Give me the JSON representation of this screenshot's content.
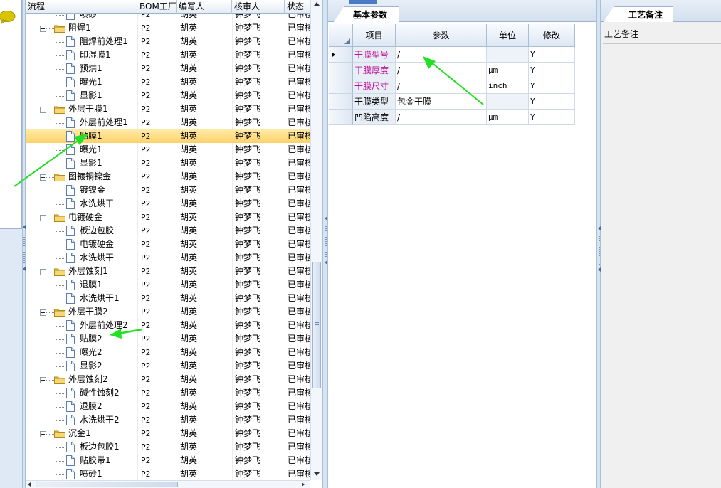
{
  "tree": {
    "columns": [
      "流程",
      "BOM工厂",
      "编写人",
      "核审人",
      "状态"
    ],
    "rows": [
      {
        "level": 1,
        "label": "喷砂",
        "bom": "P2",
        "writer": "胡英",
        "reviewer": "钟梦飞",
        "status": "已审核",
        "last_in_group": true
      },
      {
        "level": 0,
        "label": "阻焊1",
        "bom": "P2",
        "writer": "胡英",
        "reviewer": "钟梦飞",
        "status": "已审核"
      },
      {
        "level": 1,
        "label": "阻焊前处理1",
        "bom": "P2",
        "writer": "胡英",
        "reviewer": "钟梦飞",
        "status": "已审核"
      },
      {
        "level": 1,
        "label": "印湿膜1",
        "bom": "P2",
        "writer": "胡英",
        "reviewer": "钟梦飞",
        "status": "已审核"
      },
      {
        "level": 1,
        "label": "预烘1",
        "bom": "P2",
        "writer": "胡英",
        "reviewer": "钟梦飞",
        "status": "已审核"
      },
      {
        "level": 1,
        "label": "曝光1",
        "bom": "P2",
        "writer": "胡英",
        "reviewer": "钟梦飞",
        "status": "已审核"
      },
      {
        "level": 1,
        "label": "显影1",
        "bom": "P2",
        "writer": "胡英",
        "reviewer": "钟梦飞",
        "status": "已审核",
        "last_in_group": true
      },
      {
        "level": 0,
        "label": "外层干膜1",
        "bom": "P2",
        "writer": "胡英",
        "reviewer": "钟梦飞",
        "status": "已审核"
      },
      {
        "level": 1,
        "label": "外层前处理1",
        "bom": "P2",
        "writer": "胡英",
        "reviewer": "钟梦飞",
        "status": "已审核"
      },
      {
        "level": 1,
        "label": "贴膜1",
        "bom": "P2",
        "writer": "胡英",
        "reviewer": "钟梦飞",
        "status": "已审核",
        "selected": true
      },
      {
        "level": 1,
        "label": "曝光1",
        "bom": "P2",
        "writer": "胡英",
        "reviewer": "钟梦飞",
        "status": "已审核"
      },
      {
        "level": 1,
        "label": "显影1",
        "bom": "P2",
        "writer": "胡英",
        "reviewer": "钟梦飞",
        "status": "已审核",
        "last_in_group": true
      },
      {
        "level": 0,
        "label": "图镀铜镍金",
        "bom": "P2",
        "writer": "胡英",
        "reviewer": "钟梦飞",
        "status": "已审核"
      },
      {
        "level": 1,
        "label": "镀镍金",
        "bom": "P2",
        "writer": "胡英",
        "reviewer": "钟梦飞",
        "status": "已审核"
      },
      {
        "level": 1,
        "label": "水洗烘干",
        "bom": "P2",
        "writer": "胡英",
        "reviewer": "钟梦飞",
        "status": "已审核",
        "last_in_group": true
      },
      {
        "level": 0,
        "label": "电镀硬金",
        "bom": "P2",
        "writer": "胡英",
        "reviewer": "钟梦飞",
        "status": "已审核"
      },
      {
        "level": 1,
        "label": "板边包胶",
        "bom": "P2",
        "writer": "胡英",
        "reviewer": "钟梦飞",
        "status": "已审核"
      },
      {
        "level": 1,
        "label": "电镀硬金",
        "bom": "P2",
        "writer": "胡英",
        "reviewer": "钟梦飞",
        "status": "已审核"
      },
      {
        "level": 1,
        "label": "水洗烘干",
        "bom": "P2",
        "writer": "胡英",
        "reviewer": "钟梦飞",
        "status": "已审核",
        "last_in_group": true
      },
      {
        "level": 0,
        "label": "外层蚀刻1",
        "bom": "P2",
        "writer": "胡英",
        "reviewer": "钟梦飞",
        "status": "已审核"
      },
      {
        "level": 1,
        "label": "退膜1",
        "bom": "P2",
        "writer": "胡英",
        "reviewer": "钟梦飞",
        "status": "已审核"
      },
      {
        "level": 1,
        "label": "水洗烘干1",
        "bom": "P2",
        "writer": "胡英",
        "reviewer": "钟梦飞",
        "status": "已审核",
        "last_in_group": true
      },
      {
        "level": 0,
        "label": "外层干膜2",
        "bom": "P2",
        "writer": "胡英",
        "reviewer": "钟梦飞",
        "status": "已审核"
      },
      {
        "level": 1,
        "label": "外层前处理2",
        "bom": "P2",
        "writer": "胡英",
        "reviewer": "钟梦飞",
        "status": "已审核"
      },
      {
        "level": 1,
        "label": "贴膜2",
        "bom": "P2",
        "writer": "胡英",
        "reviewer": "钟梦飞",
        "status": "已审核"
      },
      {
        "level": 1,
        "label": "曝光2",
        "bom": "P2",
        "writer": "胡英",
        "reviewer": "钟梦飞",
        "status": "已审核"
      },
      {
        "level": 1,
        "label": "显影2",
        "bom": "P2",
        "writer": "胡英",
        "reviewer": "钟梦飞",
        "status": "已审核",
        "last_in_group": true
      },
      {
        "level": 0,
        "label": "外层蚀刻2",
        "bom": "P2",
        "writer": "胡英",
        "reviewer": "钟梦飞",
        "status": "已审核"
      },
      {
        "level": 1,
        "label": "碱性蚀刻2",
        "bom": "P2",
        "writer": "胡英",
        "reviewer": "钟梦飞",
        "status": "已审核"
      },
      {
        "level": 1,
        "label": "退膜2",
        "bom": "P2",
        "writer": "胡英",
        "reviewer": "钟梦飞",
        "status": "已审核"
      },
      {
        "level": 1,
        "label": "水洗烘干2",
        "bom": "P2",
        "writer": "胡英",
        "reviewer": "钟梦飞",
        "status": "已审核",
        "last_in_group": true
      },
      {
        "level": 0,
        "label": "沉金1",
        "bom": "P2",
        "writer": "胡英",
        "reviewer": "钟梦飞",
        "status": "已审核"
      },
      {
        "level": 1,
        "label": "板边包胶1",
        "bom": "P2",
        "writer": "胡英",
        "reviewer": "钟梦飞",
        "status": "已审核"
      },
      {
        "level": 1,
        "label": "贴胶带1",
        "bom": "P2",
        "writer": "胡英",
        "reviewer": "钟梦飞",
        "status": "已审核"
      },
      {
        "level": 1,
        "label": "喷砂1",
        "bom": "P2",
        "writer": "胡英",
        "reviewer": "钟梦飞",
        "status": "已审核"
      }
    ]
  },
  "params": {
    "tab_label": "基本参数",
    "columns": [
      "项目",
      "参数",
      "单位",
      "修改"
    ],
    "rows": [
      {
        "item": "干膜型号",
        "value": "/",
        "unit": "",
        "modify": "Y",
        "highlight": true,
        "current": true
      },
      {
        "item": "干膜厚度",
        "value": "/",
        "unit": "μm",
        "modify": "Y",
        "highlight": true
      },
      {
        "item": "干膜尺寸",
        "value": "/",
        "unit": "inch",
        "modify": "Y",
        "highlight": true
      },
      {
        "item": "干膜类型",
        "value": "包金干膜",
        "unit": "",
        "modify": "Y",
        "highlight": false
      },
      {
        "item": "凹陷高度",
        "value": "/",
        "unit": "μm",
        "modify": "Y",
        "highlight": false
      }
    ]
  },
  "notes": {
    "tab_label": "工艺备注",
    "title": "工艺备注"
  },
  "colors": {
    "annotation_arrow": "#22e022",
    "selected_row": "#ffd26a",
    "param_highlight": "#c0109a"
  }
}
